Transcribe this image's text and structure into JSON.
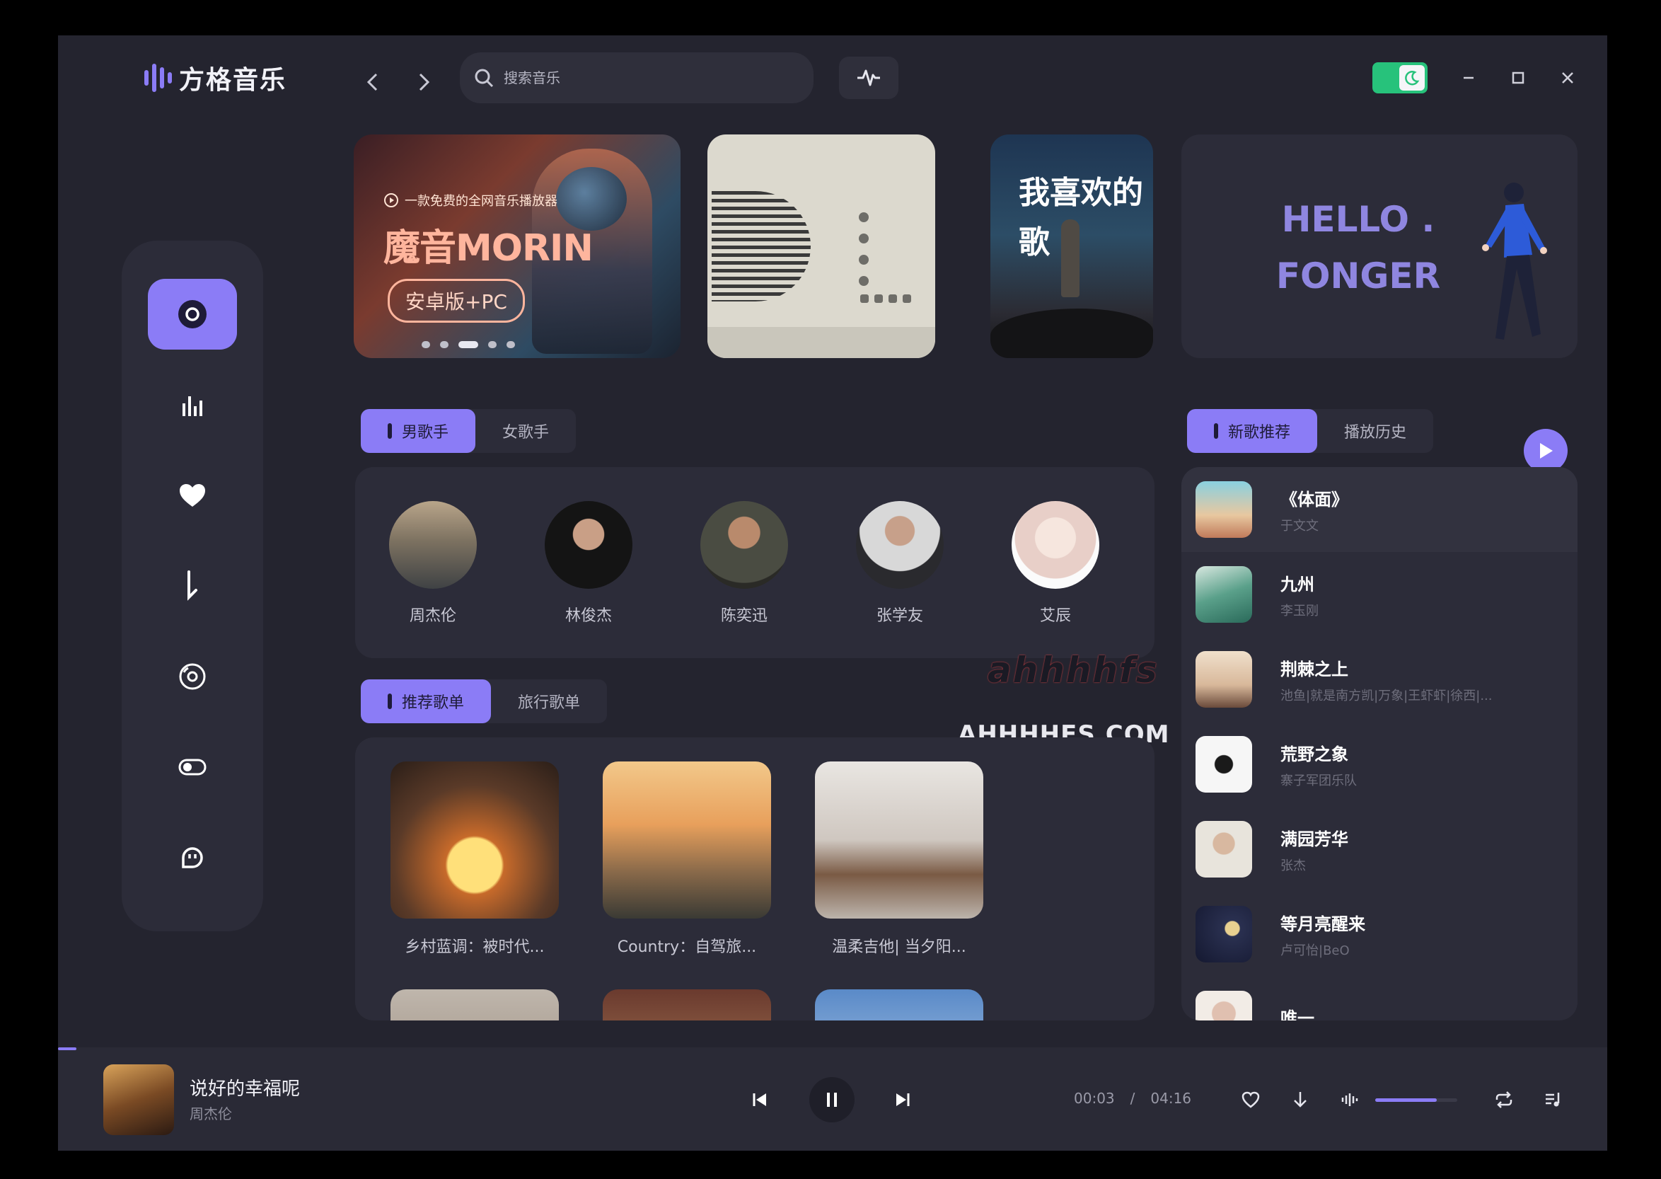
{
  "app": {
    "name": "方格音乐"
  },
  "search": {
    "placeholder": "搜索音乐"
  },
  "sidebar": {
    "items": [
      {
        "icon": "disc-icon",
        "active": true
      },
      {
        "icon": "chart-bars-icon",
        "active": false
      },
      {
        "icon": "heart-icon",
        "active": false
      },
      {
        "icon": "download-icon",
        "active": false
      },
      {
        "icon": "cd-icon",
        "active": false
      },
      {
        "icon": "toggle-icon",
        "active": false
      },
      {
        "icon": "robot-icon",
        "active": false
      }
    ]
  },
  "banners": {
    "b1": {
      "tag": "一款免费的全网音乐播放器",
      "headline": "魔音MORIN",
      "pill": "安卓版+PC"
    },
    "b3": {
      "text": "我喜欢的歌"
    },
    "b4": {
      "line1": "HELLO .",
      "line2": "FONGER"
    }
  },
  "artist_tabs": [
    {
      "label": "男歌手",
      "active": true
    },
    {
      "label": "女歌手",
      "active": false
    }
  ],
  "artists": [
    "周杰伦",
    "林俊杰",
    "陈奕迅",
    "张学友",
    "艾辰"
  ],
  "playlist_tabs": [
    {
      "label": "推荐歌单",
      "active": true
    },
    {
      "label": "旅行歌单",
      "active": false
    }
  ],
  "playlists": [
    {
      "title": "乡村蓝调：被时代..."
    },
    {
      "title": "Country：自驾旅..."
    },
    {
      "title": "温柔吉他| 当夕阳..."
    }
  ],
  "watermark": {
    "top": "ahhhhfs",
    "bottom": "AHHHHFS.COM"
  },
  "song_tabs": [
    {
      "label": "新歌推荐",
      "active": true
    },
    {
      "label": "播放历史",
      "active": false
    }
  ],
  "songs": [
    {
      "title": "《体面》",
      "artist": "于文文"
    },
    {
      "title": "九州",
      "artist": "李玉刚"
    },
    {
      "title": "荆棘之上",
      "artist": "池鱼|就是南方凯|万象|王虾虾|徐西|..."
    },
    {
      "title": "荒野之象",
      "artist": "寨子军团乐队"
    },
    {
      "title": "满园芳华",
      "artist": "张杰"
    },
    {
      "title": "等月亮醒来",
      "artist": "卢可怡|BeO"
    },
    {
      "title": "唯一",
      "artist": ""
    }
  ],
  "player": {
    "title": "说好的幸福呢",
    "artist": "周杰伦",
    "current_time": "00:03",
    "separator": "/",
    "total_time": "04:16",
    "progress": 0.012,
    "volume": 0.75
  },
  "colors": {
    "accent": "#8b7cf6",
    "bg": "#24242f",
    "panel": "#2c2c39",
    "toggle": "#27c27b"
  }
}
